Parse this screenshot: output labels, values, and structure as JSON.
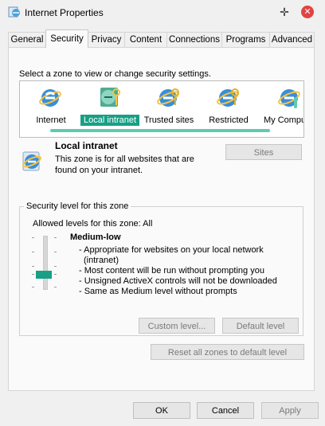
{
  "window": {
    "title": "Internet Properties"
  },
  "tabs": [
    "General",
    "Security",
    "Privacy",
    "Content",
    "Connections",
    "Programs",
    "Advanced"
  ],
  "active_tab": "Security",
  "zone_instruction": "Select a zone to view or change security settings.",
  "zones": [
    {
      "label": "Internet",
      "icon": "internet-zone-icon",
      "selected": false
    },
    {
      "label": "Local intranet",
      "icon": "local-intranet-zone-icon",
      "selected": true
    },
    {
      "label": "Trusted sites",
      "icon": "trusted-sites-zone-icon",
      "selected": false
    },
    {
      "label": "Restricted",
      "icon": "restricted-zone-icon",
      "selected": false
    },
    {
      "label": "My Computer",
      "icon": "my-computer-zone-icon",
      "selected": false
    }
  ],
  "selected_zone": {
    "name": "Local intranet",
    "description": "This zone is for all websites that are found on your intranet."
  },
  "sites_button": "Sites",
  "security_level": {
    "group_title": "Security level for this zone",
    "allowed": "Allowed levels for this zone: All",
    "level_name": "Medium-low",
    "lines": [
      "- Appropriate for websites on your local network",
      "(intranet)",
      "- Most content will be run without prompting you",
      "- Unsigned ActiveX controls will not be downloaded",
      "- Same as Medium level without prompts"
    ],
    "slider_position_fraction": 0.25
  },
  "buttons": {
    "custom_level": "Custom level...",
    "default_level": "Default level",
    "reset_all": "Reset all zones to default level",
    "ok": "OK",
    "cancel": "Cancel",
    "apply": "Apply"
  },
  "colors": {
    "accent": "#17a085",
    "close": "#e04343",
    "scroll": "#5ecbb2"
  }
}
